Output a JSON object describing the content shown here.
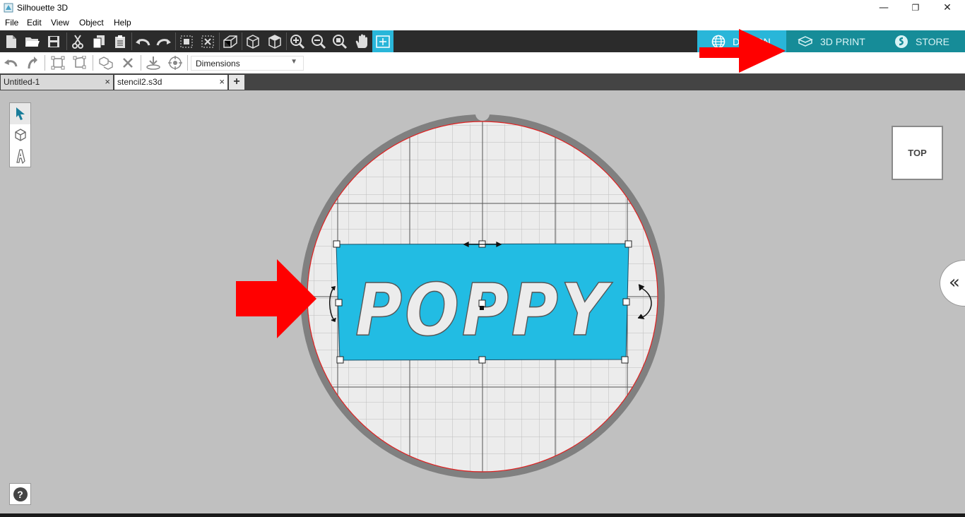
{
  "window": {
    "title": "Silhouette 3D",
    "minimize": "—",
    "restore": "❐",
    "close": "✕"
  },
  "menu": [
    "File",
    "Edit",
    "View",
    "Object",
    "Help"
  ],
  "mode_tabs": {
    "design": "DESIGN",
    "print3d": "3D PRINT",
    "store": "STORE",
    "active": "design"
  },
  "toolbar2": {
    "dimensions_label": "Dimensions",
    "dropdown_arrow": "▼"
  },
  "documents": {
    "tabs": [
      {
        "label": "Untitled-1",
        "close": "×",
        "active": false
      },
      {
        "label": "stencil2.s3d",
        "close": "×",
        "active": true
      }
    ],
    "add": "+"
  },
  "canvas": {
    "stencil_text": "POPPY",
    "stencil_color": "#22bce3",
    "disc_ring_color": "#808080",
    "grid_color": "#bdbdbd"
  },
  "viewcube": {
    "label": "TOP"
  },
  "right_panel": {
    "collapse": "«"
  },
  "help": {
    "label": "?"
  },
  "annotations": {
    "arrow_color": "#ff0000"
  }
}
